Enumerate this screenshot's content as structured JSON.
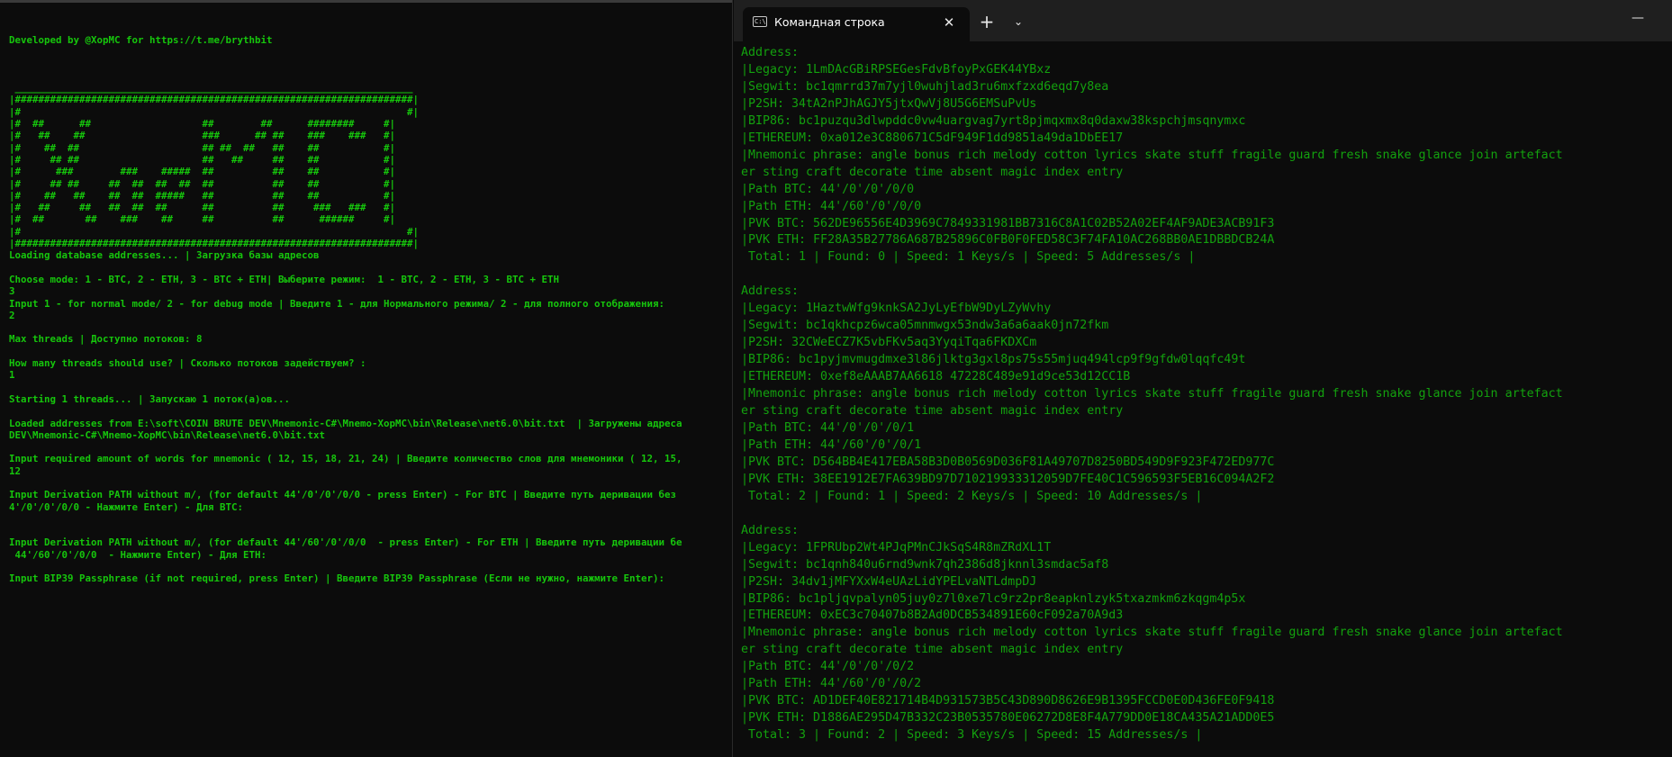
{
  "left_console": {
    "lines": [
      "Developed by @XopMC for https://t.me/brythbit",
      "",
      "",
      "",
      " ____________________________________________________________________",
      "|####################################################################|",
      "|#                                                                  #|",
      "|#  ##      ##                   ##        ##      ########     #|",
      "|#   ##    ##                    ###      ## ##    ###    ###   #|",
      "|#    ##  ##                     ## ##  ##   ##    ##           #|",
      "|#     ## ##                     ##   ##     ##    ##           #|",
      "|#      ###        ###    #####  ##          ##    ##           #|",
      "|#     ## ##     ##  ##  ##  ##  ##          ##    ##           #|",
      "|#    ##   ##    ##  ##  #####   ##          ##    ##           #|",
      "|#   ##     ##   ##  ##  ##      ##          ##     ###   ###   #|",
      "|#  ##       ##    ###    ##     ##          ##      ######     #|",
      "|#                                                                  #|",
      "|####################################################################|",
      "Loading database addresses... | Загрузка базы адресов",
      "",
      "Choose mode: 1 - BTC, 2 - ETH, 3 - BTC + ETH| Выберите режим:  1 - BTC, 2 - ETH, 3 - BTC + ETH",
      "3",
      "Input 1 - for normal mode/ 2 - for debug mode | Введите 1 - для Нормального режима/ 2 - для полного отображения:",
      "2",
      "",
      "Max threads | Доступно потоков: 8",
      "",
      "How many threads should use? | Сколько потоков задействуем? :",
      "1",
      "",
      "Starting 1 threads... | Запускаю 1 поток(а)ов...",
      "",
      "Loaded addresses from E:\\soft\\COIN BRUTE DEV\\Mnemonic-C#\\Mnemo-XopMC\\bin\\Release\\net6.0\\bit.txt  | Загружены адреса",
      "DEV\\Mnemonic-C#\\Mnemo-XopMC\\bin\\Release\\net6.0\\bit.txt",
      "",
      "Input required amount of words for mnemonic ( 12, 15, 18, 21, 24) | Введите количество слов для мнемоники ( 12, 15,",
      "12",
      "",
      "Input Derivation PATH without m/, (for default 44'/0'/0'/0/0 - press Enter) - For BTC | Введите путь деривации без",
      "4'/0'/0'/0/0 - Нажмите Enter) - Для BTC:",
      "",
      "",
      "Input Derivation PATH without m/, (for default 44'/60'/0'/0/0  - press Enter) - For ETH | Введите путь деривации бе",
      " 44'/60'/0'/0/0  - Нажмите Enter) - Для ETH:",
      "",
      "Input BIP39 Passphrase (if not required, press Enter) | Введите BIP39 Passphrase (Если не нужно, нажмите Enter):"
    ]
  },
  "terminal_tab": {
    "icon": "cmd-icon",
    "icon_text": "C:\\",
    "title": "Командная строка",
    "close_glyph": "✕",
    "new_tab_glyph": "+",
    "dropdown_glyph": "⌄",
    "minimize_glyph": "—"
  },
  "right_console": {
    "lines": [
      "Address:",
      "|Legacy: 1LmDAcGBiRPSEGesFdvBfoyPxGEK44YBxz",
      "|Segwit: bc1qmrrd37m7yjl0wuhjlad3ru6mxfzxd6eqd7y8ea",
      "|P2SH: 34tA2nPJhAGJY5jtxQwVj8U5G6EMSuPvUs",
      "|BIP86: bc1puzqu3dlwpddc0vw4uargvag7yrt8pjmqxmx8q0daxw38kspchjmsqnymxc",
      "|ETHEREUM: 0xa012e3C880671C5dF949F1dd9851a49da1DbEE17",
      "|Mnemonic phrase: angle bonus rich melody cotton lyrics skate stuff fragile guard fresh snake glance join artefact",
      "er sting craft decorate time absent magic index entry",
      "|Path BTC: 44'/0'/0'/0/0",
      "|Path ETH: 44'/60'/0'/0/0",
      "|PVK BTC: 562DE96556E4D3969C7849331981BB7316C8A1C02B52A02EF4AF9ADE3ACB91F3",
      "|PVK ETH: FF28A35B27786A687B25896C0FB0F0FED58C3F74FA10AC268BB0AE1DBBDCB24A",
      " Total: 1 | Found: 0 | Speed: 1 Keys/s | Speed: 5 Addresses/s |",
      "",
      "Address:",
      "|Legacy: 1HaztwWfg9knkSA2JyLyEfbW9DyLZyWvhy",
      "|Segwit: bc1qkhcpz6wca05mnmwgx53ndw3a6a6aak0jn72fkm",
      "|P2SH: 32CWeECZ7K5vbFKv5aq3YyqiTqa6FKDXCm",
      "|BIP86: bc1pyjmvmugdmxe3l86jlktg3gxl8ps75s55mjuq494lcp9f9gfdw0lqqfc49t",
      "|ETHEREUM: 0xef8eAAAB7AA6618 47228C489e91d9ce53d12CC1B",
      "|Mnemonic phrase: angle bonus rich melody cotton lyrics skate stuff fragile guard fresh snake glance join artefact",
      "er sting craft decorate time absent magic index entry",
      "|Path BTC: 44'/0'/0'/0/1",
      "|Path ETH: 44'/60'/0'/0/1",
      "|PVK BTC: D564BB4E417EBA58B3D0B0569D036F81A49707D8250BD549D9F923F472ED977C",
      "|PVK ETH: 38EE1912E7FA639BD97D710219933312059D7FE40C1C596593F5EB16C094A2F2",
      " Total: 2 | Found: 1 | Speed: 2 Keys/s | Speed: 10 Addresses/s |",
      "",
      "Address:",
      "|Legacy: 1FPRUbp2Wt4PJqPMnCJkSqS4R8mZRdXL1T",
      "|Segwit: bc1qnh840u6rnd9wnk7qh2386d8jknnl3smdac5af8",
      "|P2SH: 34dv1jMFYXxW4eUAzLidYPELvaNTLdmpDJ",
      "|BIP86: bc1pljqvpalyn05juy0z7l0xe7lc9rz2pr8eapknlzyk5txazmkm6zkqgm4p5x",
      "|ETHEREUM: 0xEC3c70407b8B2Ad0DCB534891E60cF092a70A9d3",
      "|Mnemonic phrase: angle bonus rich melody cotton lyrics skate stuff fragile guard fresh snake glance join artefact",
      "er sting craft decorate time absent magic index entry",
      "|Path BTC: 44'/0'/0'/0/2",
      "|Path ETH: 44'/60'/0'/0/2",
      "|PVK BTC: AD1DEF40E821714B4D931573B5C43D890D8626E9B1395FCCD0E0D436FE0F9418",
      "|PVK ETH: D1886AE295D47B332C23B0535780E06272D8E8F4A779DD0E18CA435A21ADD0E5",
      " Total: 3 | Found: 2 | Speed: 3 Keys/s | Speed: 15 Addresses/s |"
    ]
  },
  "colors": {
    "background": "#0c0c0c",
    "left_text": "#16c60c",
    "right_text": "#13a10e",
    "titlebar": "#1f1f1f"
  }
}
